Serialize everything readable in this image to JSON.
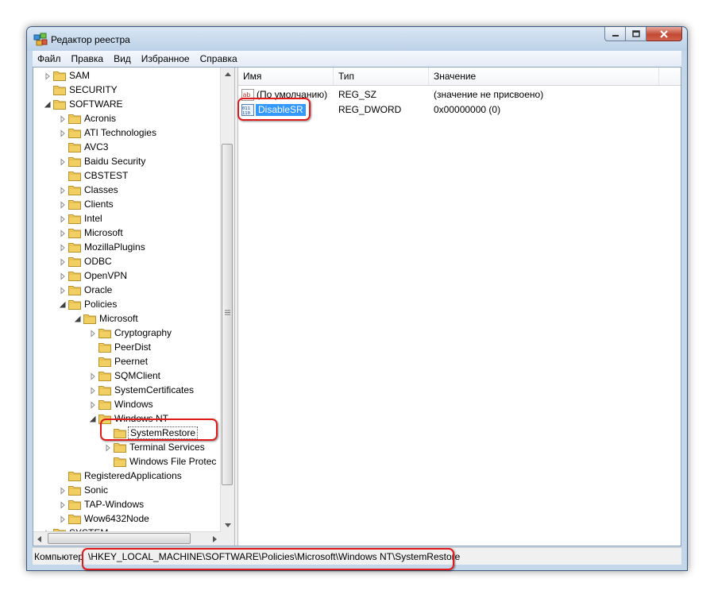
{
  "window": {
    "title": "Редактор реестра"
  },
  "menu": [
    "Файл",
    "Правка",
    "Вид",
    "Избранное",
    "Справка"
  ],
  "tree": [
    {
      "label": "SAM",
      "level": 1,
      "expander": "collapsed"
    },
    {
      "label": "SECURITY",
      "level": 1,
      "expander": "none"
    },
    {
      "label": "SOFTWARE",
      "level": 1,
      "expander": "expanded"
    },
    {
      "label": "Acronis",
      "level": 2,
      "expander": "collapsed"
    },
    {
      "label": "ATI Technologies",
      "level": 2,
      "expander": "collapsed"
    },
    {
      "label": "AVC3",
      "level": 2,
      "expander": "none"
    },
    {
      "label": "Baidu Security",
      "level": 2,
      "expander": "collapsed"
    },
    {
      "label": "CBSTEST",
      "level": 2,
      "expander": "none"
    },
    {
      "label": "Classes",
      "level": 2,
      "expander": "collapsed"
    },
    {
      "label": "Clients",
      "level": 2,
      "expander": "collapsed"
    },
    {
      "label": "Intel",
      "level": 2,
      "expander": "collapsed"
    },
    {
      "label": "Microsoft",
      "level": 2,
      "expander": "collapsed"
    },
    {
      "label": "MozillaPlugins",
      "level": 2,
      "expander": "collapsed"
    },
    {
      "label": "ODBC",
      "level": 2,
      "expander": "collapsed"
    },
    {
      "label": "OpenVPN",
      "level": 2,
      "expander": "collapsed"
    },
    {
      "label": "Oracle",
      "level": 2,
      "expander": "collapsed"
    },
    {
      "label": "Policies",
      "level": 2,
      "expander": "expanded"
    },
    {
      "label": "Microsoft",
      "level": 3,
      "expander": "expanded"
    },
    {
      "label": "Cryptography",
      "level": 4,
      "expander": "collapsed"
    },
    {
      "label": "PeerDist",
      "level": 4,
      "expander": "none"
    },
    {
      "label": "Peernet",
      "level": 4,
      "expander": "none"
    },
    {
      "label": "SQMClient",
      "level": 4,
      "expander": "collapsed"
    },
    {
      "label": "SystemCertificates",
      "level": 4,
      "expander": "collapsed"
    },
    {
      "label": "Windows",
      "level": 4,
      "expander": "collapsed"
    },
    {
      "label": "Windows NT",
      "level": 4,
      "expander": "expanded"
    },
    {
      "label": "SystemRestore",
      "level": 5,
      "expander": "none",
      "selected": true
    },
    {
      "label": "Terminal Services",
      "level": 5,
      "expander": "collapsed"
    },
    {
      "label": "Windows File Protec",
      "level": 5,
      "expander": "none"
    },
    {
      "label": "RegisteredApplications",
      "level": 2,
      "expander": "none"
    },
    {
      "label": "Sonic",
      "level": 2,
      "expander": "collapsed"
    },
    {
      "label": "TAP-Windows",
      "level": 2,
      "expander": "collapsed"
    },
    {
      "label": "Wow6432Node",
      "level": 2,
      "expander": "collapsed"
    },
    {
      "label": "SYSTEM",
      "level": 1,
      "expander": "collapsed"
    }
  ],
  "list": {
    "columns": [
      "Имя",
      "Тип",
      "Значение"
    ],
    "rows": [
      {
        "icon": "string-value-icon",
        "name": "(По умолчанию)",
        "type": "REG_SZ",
        "value": "(значение не присвоено)"
      },
      {
        "icon": "dword-value-icon",
        "name": "DisableSR",
        "type": "REG_DWORD",
        "value": "0x00000000 (0)",
        "selected": true
      }
    ]
  },
  "status": {
    "label": "Компьютер",
    "path": "\\HKEY_LOCAL_MACHINE\\SOFTWARE\\Policies\\Microsoft\\Windows NT\\SystemRestore"
  },
  "colors": {
    "highlight": "#e01b1b",
    "selection": "#3399ff",
    "folder": "#f0c850"
  }
}
